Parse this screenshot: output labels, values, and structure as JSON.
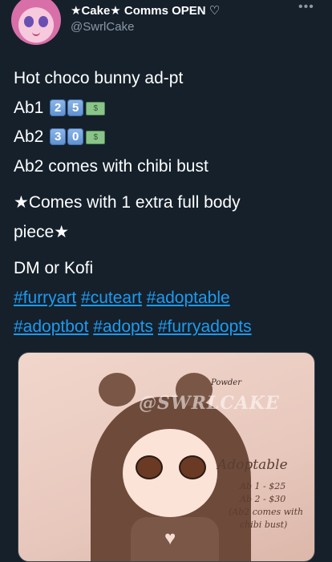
{
  "profile": {
    "display_name": "★Cake★ Comms OPEN ♡",
    "handle": "@SwrlCake",
    "more_icon": "more-dots-icon"
  },
  "tweet": {
    "line1": "Hot choco bunny ad-pt",
    "ab1_label": "Ab1",
    "ab1_digits": [
      "2",
      "5"
    ],
    "ab2_label": "Ab2",
    "ab2_digits": [
      "3",
      "0"
    ],
    "money_emoji": "$",
    "line4": "Ab2 comes with chibi bust",
    "line5a": "★Comes with 1 extra full body",
    "line5b": "piece★",
    "line6": "DM or Kofi",
    "hashtags_line1": [
      "#furryart",
      "#cuteart",
      "#adoptable"
    ],
    "hashtags_line2": [
      "#adoptbot",
      "#adopts",
      "#furryadopts"
    ]
  },
  "media": {
    "watermark": "@SWRLCAKE",
    "signature": "Powder",
    "title": "Adoptable",
    "lines": [
      "Ab 1 - $25",
      "Ab 2 - $30",
      "(Ab2 comes with",
      "chibi bust)"
    ]
  },
  "colors": {
    "background": "#15202b",
    "link": "#1d9bf0",
    "muted": "#8b98a5"
  }
}
